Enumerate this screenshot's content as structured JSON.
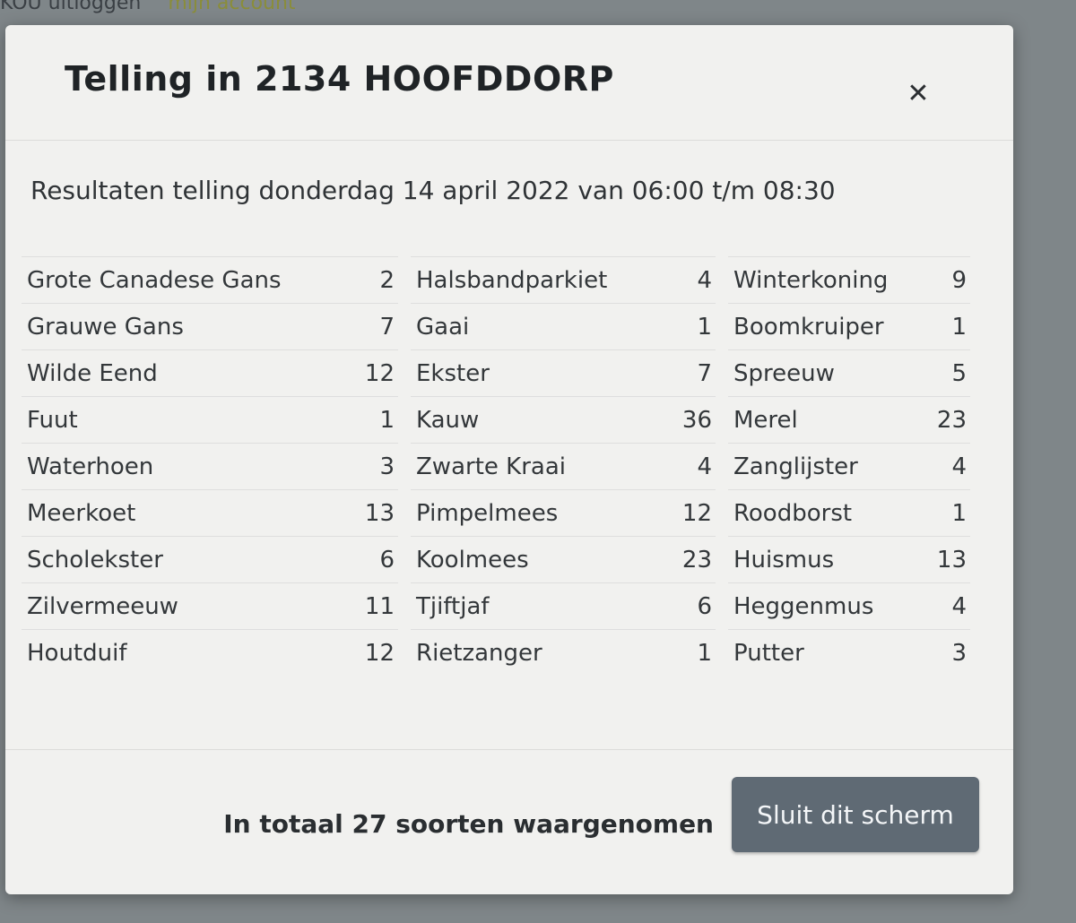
{
  "background_nav": {
    "logout_label": "KOU uitloggen",
    "account_label": "mijn account"
  },
  "modal": {
    "title": "Telling in 2134 HOOFDDORP",
    "close_icon": "close-icon",
    "close_glyph": "✕",
    "subtitle": "Resultaten telling donderdag 14 april 2022 van 06:00 t/m 08:30",
    "columns": [
      [
        {
          "name": "Grote Canadese Gans",
          "count": "2"
        },
        {
          "name": "Grauwe Gans",
          "count": "7"
        },
        {
          "name": "Wilde Eend",
          "count": "12"
        },
        {
          "name": "Fuut",
          "count": "1"
        },
        {
          "name": "Waterhoen",
          "count": "3"
        },
        {
          "name": "Meerkoet",
          "count": "13"
        },
        {
          "name": "Scholekster",
          "count": "6"
        },
        {
          "name": "Zilvermeeuw",
          "count": "11"
        },
        {
          "name": "Houtduif",
          "count": "12"
        }
      ],
      [
        {
          "name": "Halsbandparkiet",
          "count": "4"
        },
        {
          "name": "Gaai",
          "count": "1"
        },
        {
          "name": "Ekster",
          "count": "7"
        },
        {
          "name": "Kauw",
          "count": "36"
        },
        {
          "name": "Zwarte Kraai",
          "count": "4"
        },
        {
          "name": "Pimpelmees",
          "count": "12"
        },
        {
          "name": "Koolmees",
          "count": "23"
        },
        {
          "name": "Tjiftjaf",
          "count": "6"
        },
        {
          "name": "Rietzanger",
          "count": "1"
        }
      ],
      [
        {
          "name": "Winterkoning",
          "count": "9"
        },
        {
          "name": "Boomkruiper",
          "count": "1"
        },
        {
          "name": "Spreeuw",
          "count": "5"
        },
        {
          "name": "Merel",
          "count": "23"
        },
        {
          "name": "Zanglijster",
          "count": "4"
        },
        {
          "name": "Roodborst",
          "count": "1"
        },
        {
          "name": "Huismus",
          "count": "13"
        },
        {
          "name": "Heggenmus",
          "count": "4"
        },
        {
          "name": "Putter",
          "count": "3"
        }
      ]
    ],
    "footer": {
      "total_text": "In totaal 27 soorten waargenomen",
      "close_button_label": "Sluit dit scherm"
    }
  },
  "colors": {
    "modal_background": "#f1f1ef",
    "button_background": "#5f6a74",
    "text": "#33373a"
  }
}
